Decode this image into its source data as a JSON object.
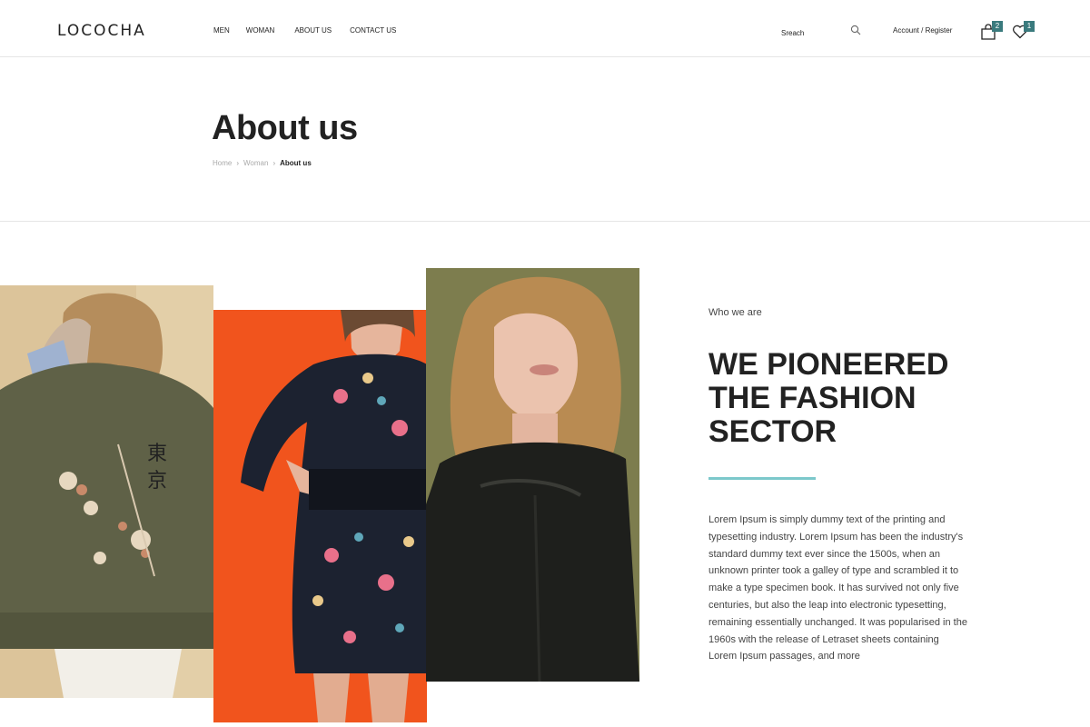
{
  "header": {
    "logo": "LOCOCHA",
    "nav": [
      "MEN",
      "WOMAN",
      "ABOUT US",
      "CONTACT US"
    ],
    "search_placeholder": "Sreach",
    "account": "Account / Register",
    "cart_count": "2",
    "wishlist_count": "1",
    "icons": {
      "search": "search-icon",
      "cart": "shopping-bag-icon",
      "wishlist": "heart-icon"
    }
  },
  "page": {
    "title": "About us",
    "breadcrumb": [
      "Home",
      "Woman",
      "About us"
    ]
  },
  "about": {
    "eyebrow": "Who we are",
    "headline": "WE PIONEERED THE FASHION SECTOR",
    "body": "Lorem Ipsum is simply dummy text of the printing and typesetting industry. Lorem Ipsum has been the industry's standard dummy text ever since the 1500s, when an unknown printer took a galley of type and scrambled it to make a type specimen book. It has survived not only five centuries, but also the leap into electronic typesetting, remaining essentially unchanged. It was popularised in the 1960s with the release of Letraset sheets containing Lorem Ipsum passages, and more"
  },
  "colors": {
    "accent": "#7cc8cb",
    "badge": "#3a7a7d"
  }
}
